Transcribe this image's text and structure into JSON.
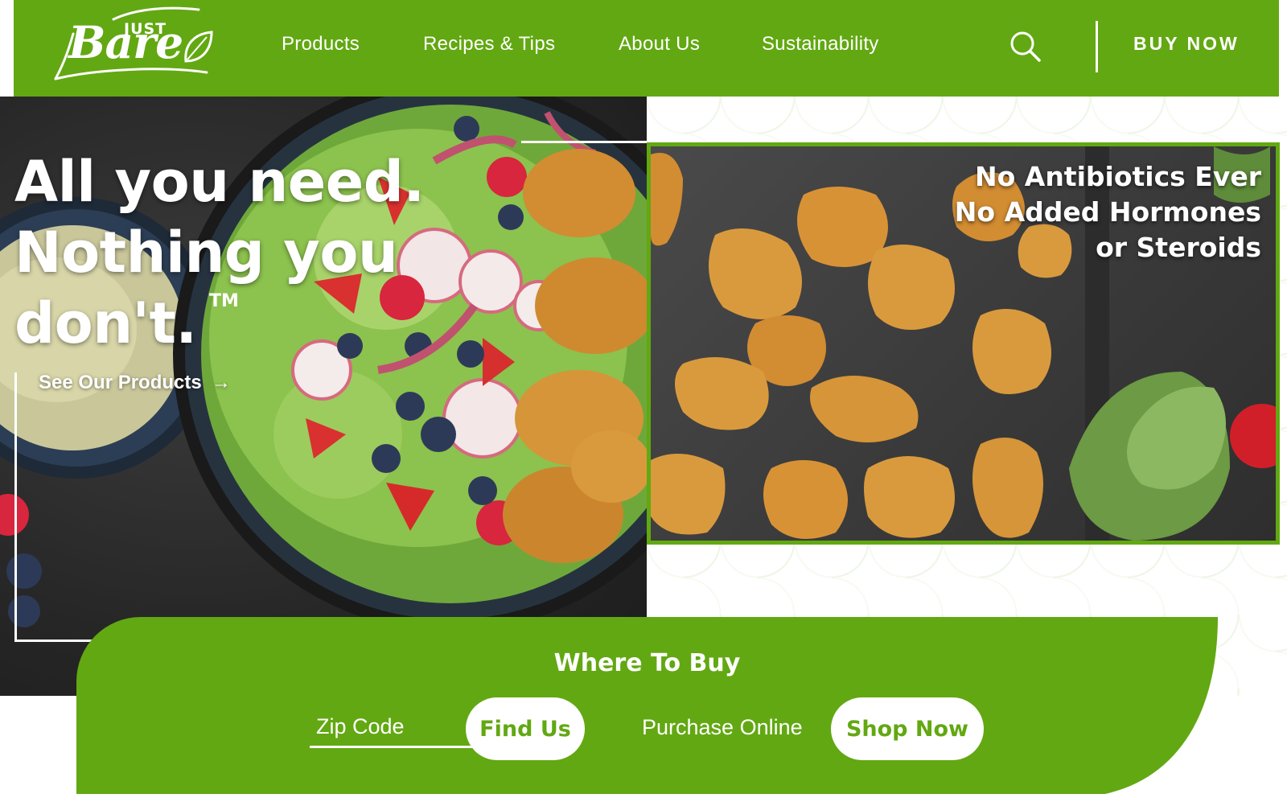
{
  "brand": {
    "logo_small": "JUST",
    "logo_large": "Bare"
  },
  "nav": {
    "items": [
      {
        "label": "Products"
      },
      {
        "label": "Recipes & Tips"
      },
      {
        "label": "About Us"
      },
      {
        "label": "Sustainability"
      }
    ],
    "search_icon": "search-icon",
    "cta": "BUY NOW"
  },
  "hero": {
    "headline_line1": "All you need.",
    "headline_line2": "Nothing you",
    "headline_line3": "don't.",
    "trademark": "TM",
    "cta_label": "See Our Products",
    "cta_arrow": "→"
  },
  "claims": {
    "line1": "No Antibiotics Ever",
    "line2": "No Added Hormones",
    "line3": "or Steroids"
  },
  "where_to_buy": {
    "title": "Where To Buy",
    "zip_placeholder": "Zip Code",
    "zip_value": "",
    "find_button": "Find Us",
    "purchase_label": "Purchase Online",
    "shop_button": "Shop Now"
  },
  "colors": {
    "brand_green": "#62a812",
    "white": "#ffffff",
    "dark_background": "#2a2a2a"
  }
}
